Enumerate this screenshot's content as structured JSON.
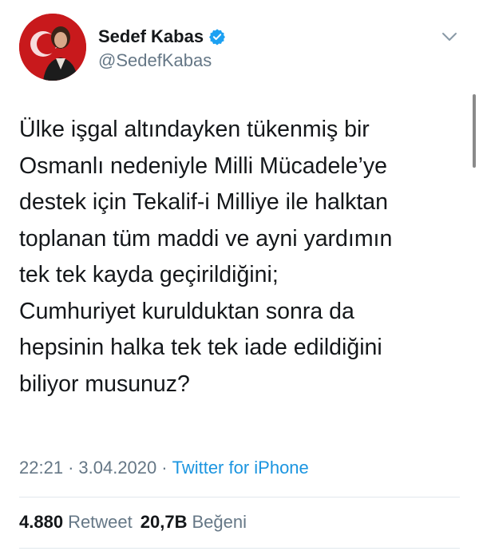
{
  "author": {
    "display_name": "Sedef Kabas",
    "handle": "@SedefKabas",
    "verified_icon": "verified-badge-icon",
    "verified_color": "#1da1f2"
  },
  "menu": {
    "icon": "chevron-down-icon"
  },
  "tweet": {
    "lines": [
      "Ülke işgal altındayken tükenmiş bir",
      "Osmanlı nedeniyle Milli Mücadele’ye",
      "destek için Tekalif-i Milliye ile halktan",
      "toplanan tüm maddi ve ayni yardımın",
      "tek tek kayda geçirildiğini;",
      "Cumhuriyet kurulduktan sonra da",
      "hepsinin halka tek tek iade edildiğini",
      "biliyor musunuz?"
    ]
  },
  "meta": {
    "time": "22:21",
    "separator": "·",
    "date": "3.04.2020",
    "source": "Twitter for iPhone"
  },
  "stats": {
    "retweets": {
      "count": "4.880",
      "label": "Retweet"
    },
    "likes": {
      "count": "20,7B",
      "label": "Beğeni"
    }
  },
  "colors": {
    "text": "#14171a",
    "secondary": "#657786",
    "link": "#1b95e0",
    "divider": "#e1e8ed"
  }
}
